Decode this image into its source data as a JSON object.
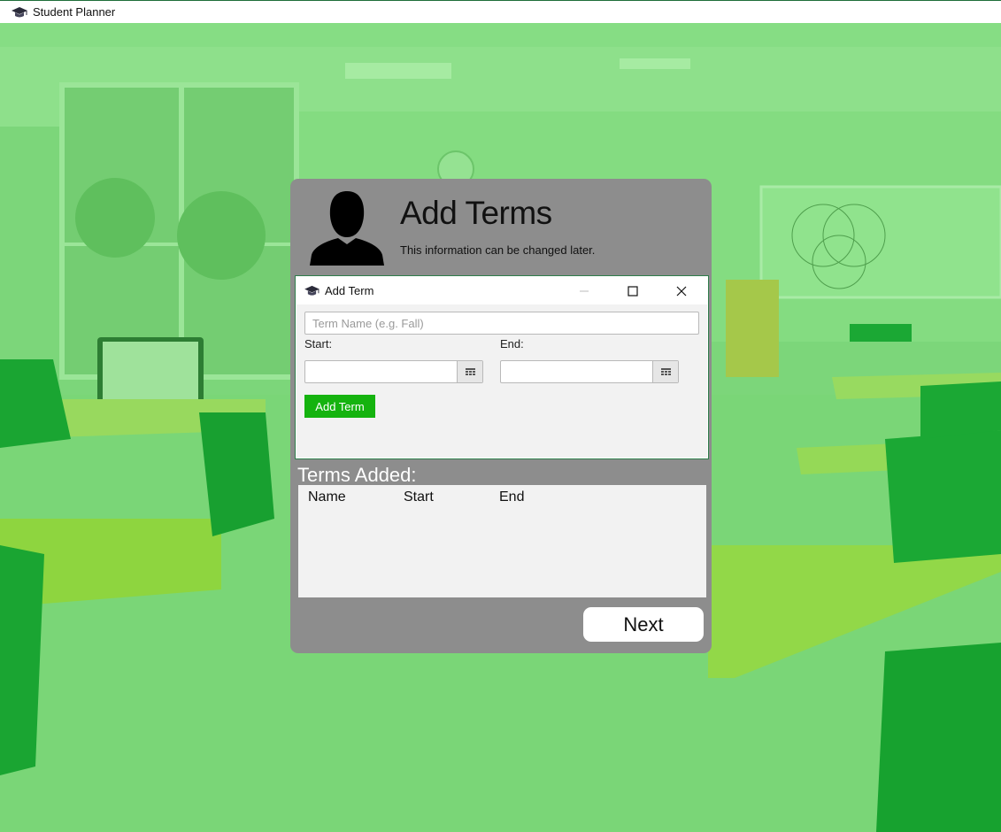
{
  "app": {
    "title": "Student Planner",
    "accent": "#7cd67a"
  },
  "panel": {
    "title": "Add Terms",
    "subtitle": "This information can be changed later."
  },
  "dialog": {
    "title": "Add Term",
    "term_name_placeholder": "Term Name (e.g. Fall)",
    "start_label": "Start:",
    "end_label": "End:",
    "add_button": "Add Term",
    "button_color": "#15b30f"
  },
  "terms": {
    "heading": "Terms Added:",
    "columns": [
      "Name",
      "Start",
      "End"
    ],
    "rows": []
  },
  "next_button": "Next",
  "icons": {
    "app": "graduation-cap-icon",
    "avatar": "user-silhouette-icon",
    "calendar": "calendar-icon",
    "minimize": "minimize-icon",
    "maximize": "maximize-icon",
    "close": "close-icon"
  }
}
